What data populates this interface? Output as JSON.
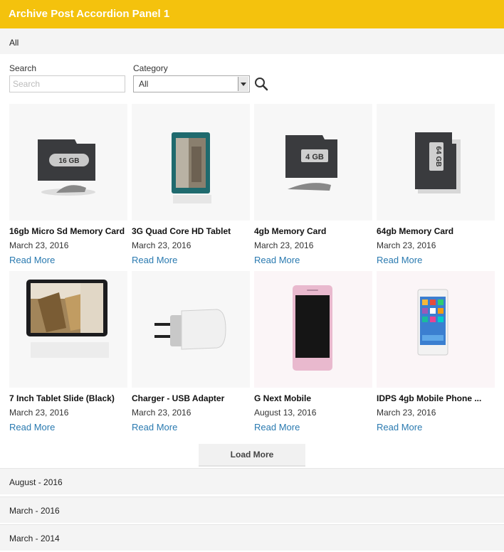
{
  "panel": {
    "title": "Archive Post Accordion Panel 1"
  },
  "filter_bar": {
    "label": "All"
  },
  "filters": {
    "search_label": "Search",
    "search_placeholder": "Search",
    "category_label": "Category",
    "category_selected": "All"
  },
  "products": [
    {
      "title": "16gb Micro Sd Memory Card",
      "date": "March 23, 2016",
      "link": "Read More",
      "icon": "micro-sd-card-16gb",
      "card_text": "16 GB"
    },
    {
      "title": "3G Quad Core HD Tablet",
      "date": "March 23, 2016",
      "link": "Read More",
      "icon": "tablet-teal"
    },
    {
      "title": "4gb Memory Card",
      "date": "March 23, 2016",
      "link": "Read More",
      "icon": "micro-sd-card-4gb",
      "card_text": "4 GB"
    },
    {
      "title": "64gb Memory Card",
      "date": "March 23, 2016",
      "link": "Read More",
      "icon": "micro-sd-card-64gb",
      "card_text": "64 GB"
    },
    {
      "title": "7 Inch Tablet Slide (Black)",
      "date": "March 23, 2016",
      "link": "Read More",
      "icon": "tablet-black"
    },
    {
      "title": "Charger - USB Adapter",
      "date": "March 23, 2016",
      "link": "Read More",
      "icon": "usb-charger"
    },
    {
      "title": "G Next Mobile",
      "date": "August 13, 2016",
      "link": "Read More",
      "icon": "phone-pink"
    },
    {
      "title": "IDPS 4gb Mobile Phone ...",
      "date": "March 23, 2016",
      "link": "Read More",
      "icon": "phone-white"
    }
  ],
  "load_more": "Load More",
  "accordion": [
    {
      "label": "August - 2016"
    },
    {
      "label": "March - 2016"
    },
    {
      "label": "March - 2014"
    }
  ],
  "colors": {
    "header": "#f4c20d",
    "link": "#2a7ab0",
    "panel_bg": "#f4f4f4"
  }
}
